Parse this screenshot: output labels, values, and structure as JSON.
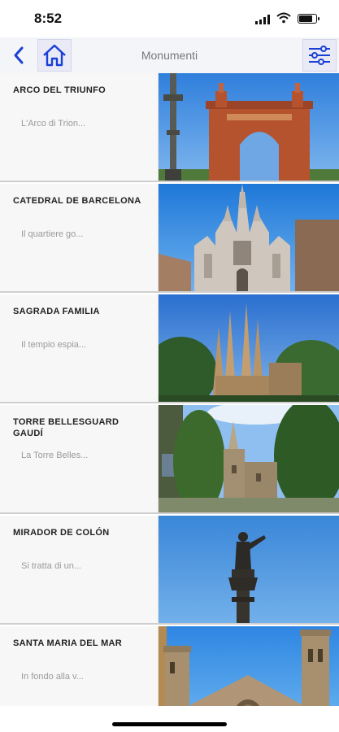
{
  "status_bar": {
    "time": "8:52"
  },
  "navbar": {
    "title": "Monumenti"
  },
  "items": [
    {
      "title": "ARCO DEL TRIUNFO",
      "description": "L'Arco di Trion..."
    },
    {
      "title": "CATEDRAL DE BARCELONA",
      "description": "Il quartiere go..."
    },
    {
      "title": "SAGRADA FAMILIA",
      "description": "Il tempio espia..."
    },
    {
      "title": "TORRE BELLESGUARD GAUDÍ",
      "description": "La Torre Belles..."
    },
    {
      "title": "MIRADOR DE COLÓN",
      "description": "Si tratta di un..."
    },
    {
      "title": "SANTA MARIA DEL MAR",
      "description": "In fondo alla v..."
    }
  ],
  "colors": {
    "accent": "#1a3fd6",
    "sky": "#3f8fe0"
  },
  "icons": [
    "back-chevron-icon",
    "home-icon",
    "filter-sliders-icon",
    "signal-icon",
    "wifi-icon",
    "battery-icon"
  ]
}
